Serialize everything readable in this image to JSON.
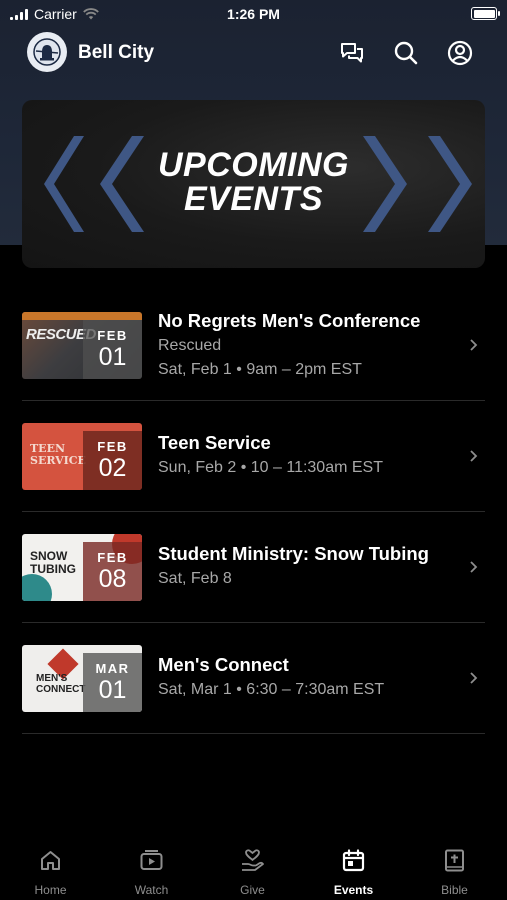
{
  "status_bar": {
    "carrier": "Carrier",
    "time": "1:26 PM"
  },
  "header": {
    "title": "Bell City",
    "icons": [
      "chat-icon",
      "search-icon",
      "profile-icon"
    ]
  },
  "banner": {
    "line1": "UPCOMING",
    "line2": "EVENTS"
  },
  "events": [
    {
      "title": "No Regrets Men's Conference",
      "subtitle": "Rescued",
      "when": "Sat, Feb 1 • 9am – 2pm EST",
      "month": "FEB",
      "day": "01",
      "thumb_text": "RESCUED",
      "accent": "#b8462f"
    },
    {
      "title": "Teen Service",
      "subtitle": "",
      "when": "Sun, Feb 2 • 10 – 11:30am EST",
      "month": "FEB",
      "day": "02",
      "thumb_text": "TEEN SERVICE",
      "accent": "#d9533f"
    },
    {
      "title": "Student Ministry: Snow Tubing",
      "subtitle": "",
      "when": "Sat, Feb 8",
      "month": "FEB",
      "day": "08",
      "thumb_text": "SNOW TUBING",
      "accent": "#2e8a8a"
    },
    {
      "title": "Men's Connect",
      "subtitle": "",
      "when": "Sat, Mar 1 • 6:30 – 7:30am EST",
      "month": "MAR",
      "day": "01",
      "thumb_text": "MEN'S CONNECT",
      "accent": "#c0392b"
    }
  ],
  "tabs": [
    {
      "label": "Home",
      "icon": "home-icon",
      "active": false
    },
    {
      "label": "Watch",
      "icon": "play-icon",
      "active": false
    },
    {
      "label": "Give",
      "icon": "give-heart-icon",
      "active": false
    },
    {
      "label": "Events",
      "icon": "calendar-icon",
      "active": true
    },
    {
      "label": "Bible",
      "icon": "bible-icon",
      "active": false
    }
  ],
  "colors": {
    "background": "#000000",
    "header_bg": "#1e2738",
    "chevron_blue": "#3f5785",
    "muted_text": "#a8a8a8"
  }
}
